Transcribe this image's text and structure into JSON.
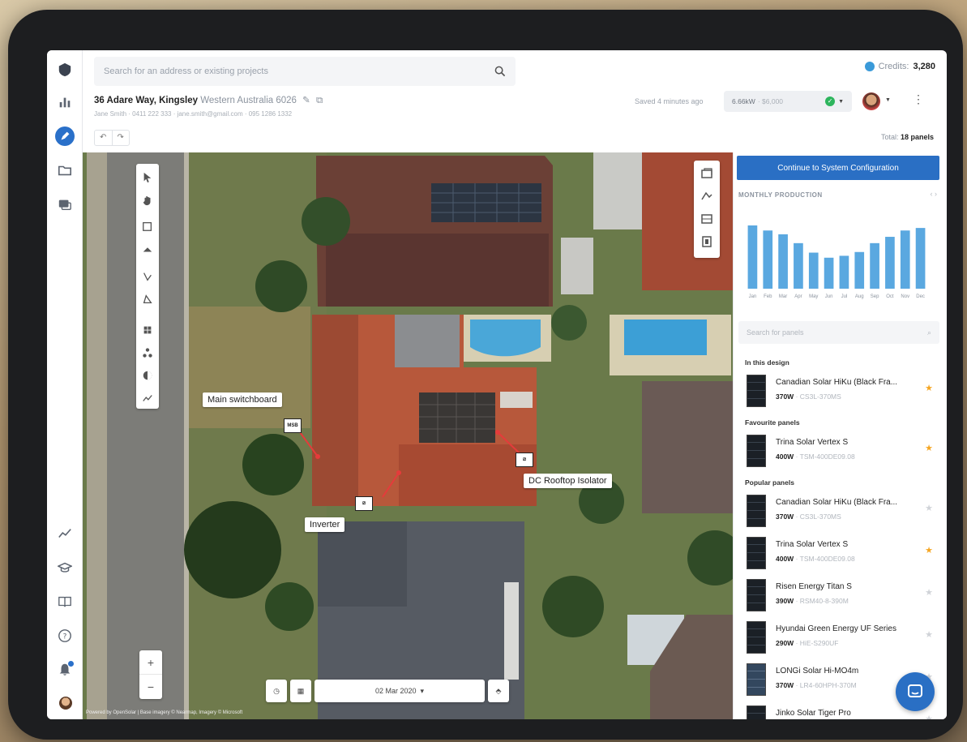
{
  "header": {
    "search_placeholder": "Search for an address or existing projects",
    "credits_label": "Credits:",
    "credits_value": "3,280",
    "address": "36 Adare Way, Kingsley",
    "region": "Western Australia 6026",
    "contact": "Jane Smith · 0411 222 333 · jane.smith@gmail.com · 095 1286 1332",
    "saved": "Saved 4 minutes ago",
    "system_size": "6.66kW",
    "price": "· $6,000",
    "total_label": "Total:",
    "total_value": "18 panels"
  },
  "map": {
    "callouts": {
      "switchboard": "Main switchboard",
      "isolator": "DC Rooftop Isolator",
      "inverter": "Inverter"
    },
    "msb_label": "MSB",
    "date": "02 Mar 2020",
    "powered_by": "Powered by OpenSolar | Base imagery © Nearmap, Imagery © Microsoft"
  },
  "panel": {
    "cta": "Continue to System Configuration",
    "monthly_title": "MONTHLY PRODUCTION",
    "search_placeholder": "Search for panels",
    "sections": {
      "in_design": "In this design",
      "favourite": "Favourite panels",
      "popular": "Popular panels"
    },
    "items": [
      {
        "name": "Canadian Solar HiKu (Black Fra...",
        "watt": "370W",
        "model": "· CS3L-370MS",
        "starred": true,
        "light": false
      },
      {
        "name": "Trina Solar Vertex S",
        "watt": "400W",
        "model": "· TSM-400DE09.08",
        "starred": true,
        "light": false
      },
      {
        "name": "Canadian Solar HiKu (Black Fra...",
        "watt": "370W",
        "model": "· CS3L-370MS",
        "starred": false,
        "light": false
      },
      {
        "name": "Trina Solar Vertex S",
        "watt": "400W",
        "model": "· TSM-400DE09.08",
        "starred": true,
        "light": false
      },
      {
        "name": "Risen Energy Titan S",
        "watt": "390W",
        "model": "· RSM40-8-390M",
        "starred": false,
        "light": false
      },
      {
        "name": "Hyundai Green Energy UF Series",
        "watt": "290W",
        "model": "· HiE-S290UF",
        "starred": false,
        "light": false
      },
      {
        "name": "LONGi Solar Hi-MO4m",
        "watt": "370W",
        "model": "· LR4-60HPH-370M",
        "starred": false,
        "light": true
      },
      {
        "name": "Jinko Solar Tiger Pro",
        "watt": "",
        "model": "",
        "starred": false,
        "light": false
      }
    ]
  },
  "chart_data": {
    "type": "bar",
    "title": "MONTHLY PRODUCTION",
    "categories": [
      "Jan",
      "Feb",
      "Mar",
      "Apr",
      "May",
      "Jun",
      "Jul",
      "Aug",
      "Sep",
      "Oct",
      "Nov",
      "Dec"
    ],
    "values": [
      100,
      92,
      86,
      72,
      57,
      49,
      52,
      58,
      72,
      82,
      92,
      96
    ],
    "ylim": [
      0,
      100
    ],
    "color": "#5aa8e0"
  }
}
